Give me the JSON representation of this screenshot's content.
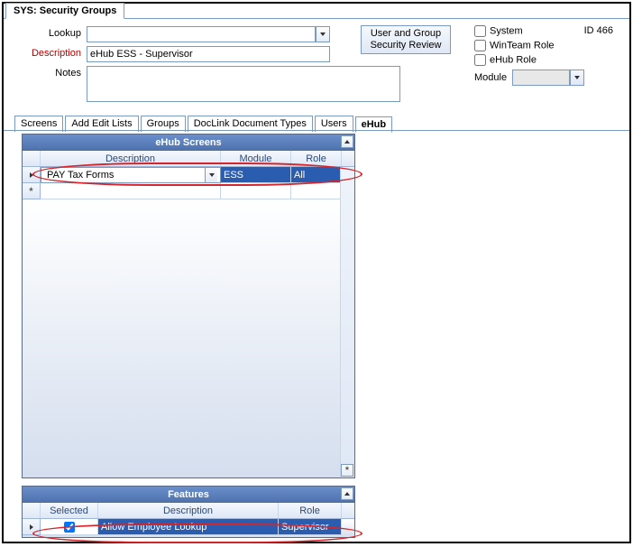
{
  "window": {
    "title": "SYS: Security Groups",
    "id_prefix": "ID",
    "id_value": "466"
  },
  "form": {
    "lookup_label": "Lookup",
    "lookup_value": "",
    "desc_label": "Description",
    "desc_value": "eHub ESS - Supervisor",
    "notes_label": "Notes",
    "notes_value": ""
  },
  "review_button": {
    "line1": "User and Group",
    "line2": "Security Review"
  },
  "options": {
    "system": "System",
    "winteam": "WinTeam Role",
    "ehub": "eHub Role",
    "module_label": "Module",
    "module_value": ""
  },
  "tabs": [
    "Screens",
    "Add Edit Lists",
    "Groups",
    "DocLink Document Types",
    "Users",
    "eHub"
  ],
  "active_tab": "eHub",
  "screens_grid": {
    "title": "eHub Screens",
    "cols": [
      "Description",
      "Module",
      "Role"
    ],
    "row": {
      "description": "PAY Tax Forms",
      "module": "ESS",
      "role": "All"
    }
  },
  "features_grid": {
    "title": "Features",
    "cols": [
      "Selected",
      "Description",
      "Role"
    ],
    "row": {
      "selected": true,
      "description": "Allow Employee Lookup",
      "role": "Supervisor"
    }
  }
}
